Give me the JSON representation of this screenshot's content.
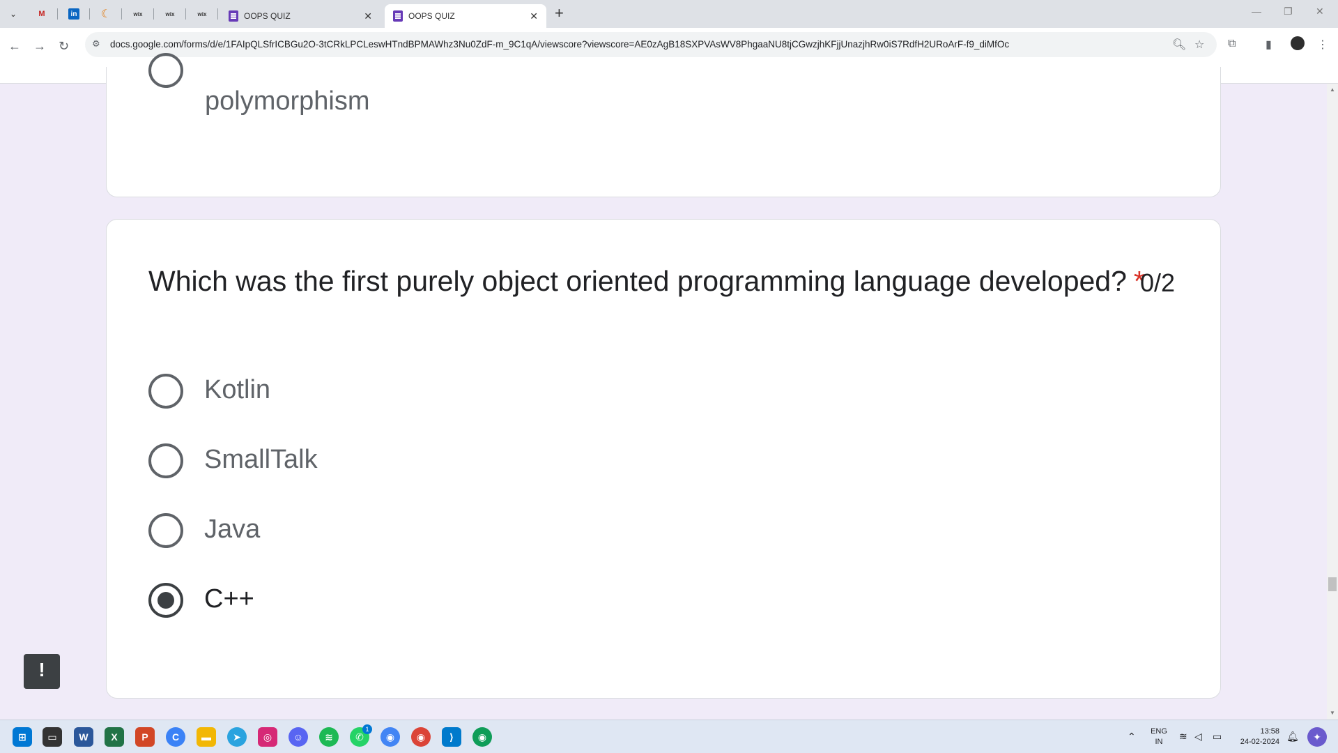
{
  "browser": {
    "tabs": [
      {
        "title": "OOPS QUIZ",
        "active": false
      },
      {
        "title": "OOPS QUIZ",
        "active": true
      }
    ],
    "pinned_tabs": [
      "M",
      "in",
      "☾",
      "wix",
      "wix",
      "wix"
    ],
    "url": "docs.google.com/forms/d/e/1FAIpQLSfrICBGu2O-3tCRkLPCLeswHTndBPMAWhz3Nu0ZdF-m_9C1qA/viewscore?viewscore=AE0zAgB18SXPVAsWV8PhgaaNU8tjCGwzjhKFjjUnazjhRw0iS7RdfH2URoArF-f9_diMfOc"
  },
  "previous_card": {
    "last_option": "polymorphism"
  },
  "question_card": {
    "question": "Which was the first purely object oriented programming language developed?",
    "required_marker": "*",
    "score": "0/2",
    "options": [
      {
        "label": "Kotlin",
        "selected": false
      },
      {
        "label": "SmallTalk",
        "selected": false
      },
      {
        "label": "Java",
        "selected": false
      },
      {
        "label": "C++",
        "selected": true
      }
    ]
  },
  "feedback_button": "!",
  "taskbar": {
    "apps": [
      "windows-start",
      "file-explorer-alt",
      "word",
      "excel",
      "powerpoint",
      "edge-c",
      "folder",
      "telegram",
      "instagram",
      "discord",
      "spotify",
      "whatsapp",
      "chrome",
      "chrome-profile",
      "vscode",
      "chrome-profile-2"
    ],
    "whatsapp_badge": "1",
    "language": "ENG",
    "region": "IN",
    "time": "13:58",
    "date": "24-02-2024"
  },
  "colors": {
    "background": "#f0ebf8",
    "accent": "#673ab7",
    "required": "#d93025"
  }
}
